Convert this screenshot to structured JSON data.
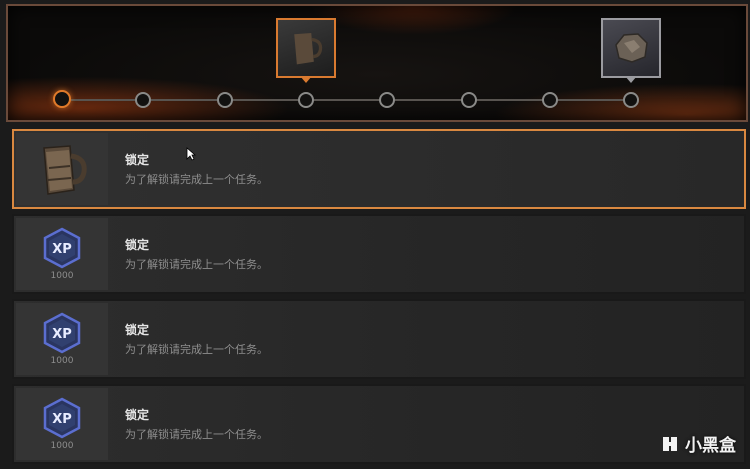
{
  "progress": {
    "node_count": 8,
    "active_index": 0,
    "reward_tiles": [
      {
        "node_index": 3,
        "style": "orange",
        "icon": "mug-icon"
      },
      {
        "node_index": 7,
        "style": "grey",
        "icon": "ore-chunk-icon"
      }
    ]
  },
  "rows": [
    {
      "icon": "mug-icon",
      "title": "锁定",
      "desc": "为了解锁请完成上一个任务。",
      "selected": true
    },
    {
      "icon": "xp-badge-icon",
      "xp_label": "XP",
      "amount": "1000",
      "title": "锁定",
      "desc": "为了解锁请完成上一个任务。",
      "selected": false
    },
    {
      "icon": "xp-badge-icon",
      "xp_label": "XP",
      "amount": "1000",
      "title": "锁定",
      "desc": "为了解锁请完成上一个任务。",
      "selected": false
    },
    {
      "icon": "xp-badge-icon",
      "xp_label": "XP",
      "amount": "1000",
      "title": "锁定",
      "desc": "为了解锁请完成上一个任务。",
      "selected": false
    }
  ],
  "watermark": {
    "text": "小黑盒",
    "icon": "heybox-logo-icon"
  },
  "colors": {
    "accent": "#d98840",
    "node": "#8a8a88",
    "xp_badge": "#4a5bb0"
  }
}
